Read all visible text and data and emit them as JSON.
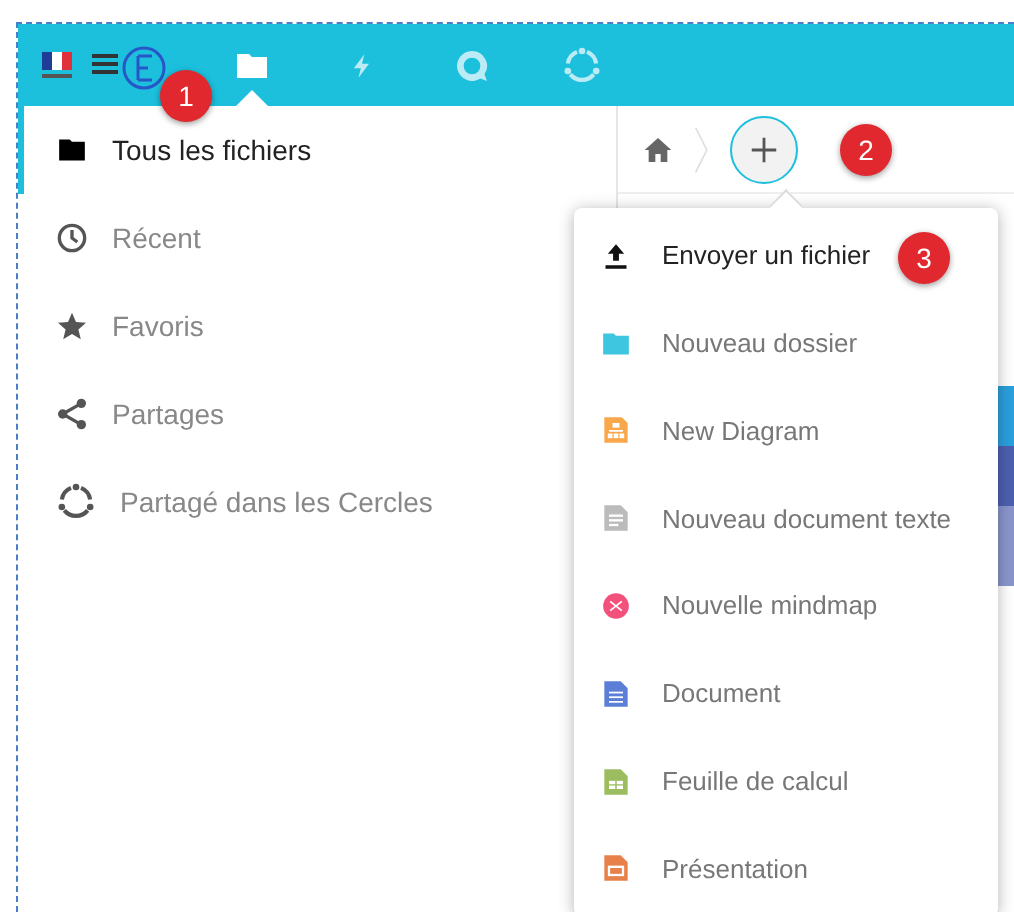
{
  "header": {
    "apps": [
      {
        "kind": "folder",
        "selected": true
      },
      {
        "kind": "bolt",
        "selected": false
      },
      {
        "kind": "chat",
        "selected": false
      },
      {
        "kind": "circles",
        "selected": false
      }
    ]
  },
  "sidebar": {
    "items": [
      {
        "kind": "folder",
        "label": "Tous les fichiers",
        "selected": true
      },
      {
        "kind": "clock",
        "label": "Récent",
        "selected": false
      },
      {
        "kind": "star",
        "label": "Favoris",
        "selected": false
      },
      {
        "kind": "share",
        "label": "Partages",
        "selected": false
      },
      {
        "kind": "circles",
        "label": "Partagé dans les Cercles",
        "selected": false
      }
    ]
  },
  "new_menu": {
    "items": [
      {
        "kind": "upload",
        "label": "Envoyer un fichier"
      },
      {
        "kind": "folder",
        "label": "Nouveau dossier"
      },
      {
        "kind": "diagram",
        "label": "New Diagram"
      },
      {
        "kind": "text",
        "label": "Nouveau document texte"
      },
      {
        "kind": "mindmap",
        "label": "Nouvelle mindmap"
      },
      {
        "kind": "document",
        "label": "Document"
      },
      {
        "kind": "spreadsheet",
        "label": "Feuille de calcul"
      },
      {
        "kind": "presentation",
        "label": "Présentation"
      }
    ]
  },
  "step_badges": [
    "1",
    "2",
    "3"
  ]
}
